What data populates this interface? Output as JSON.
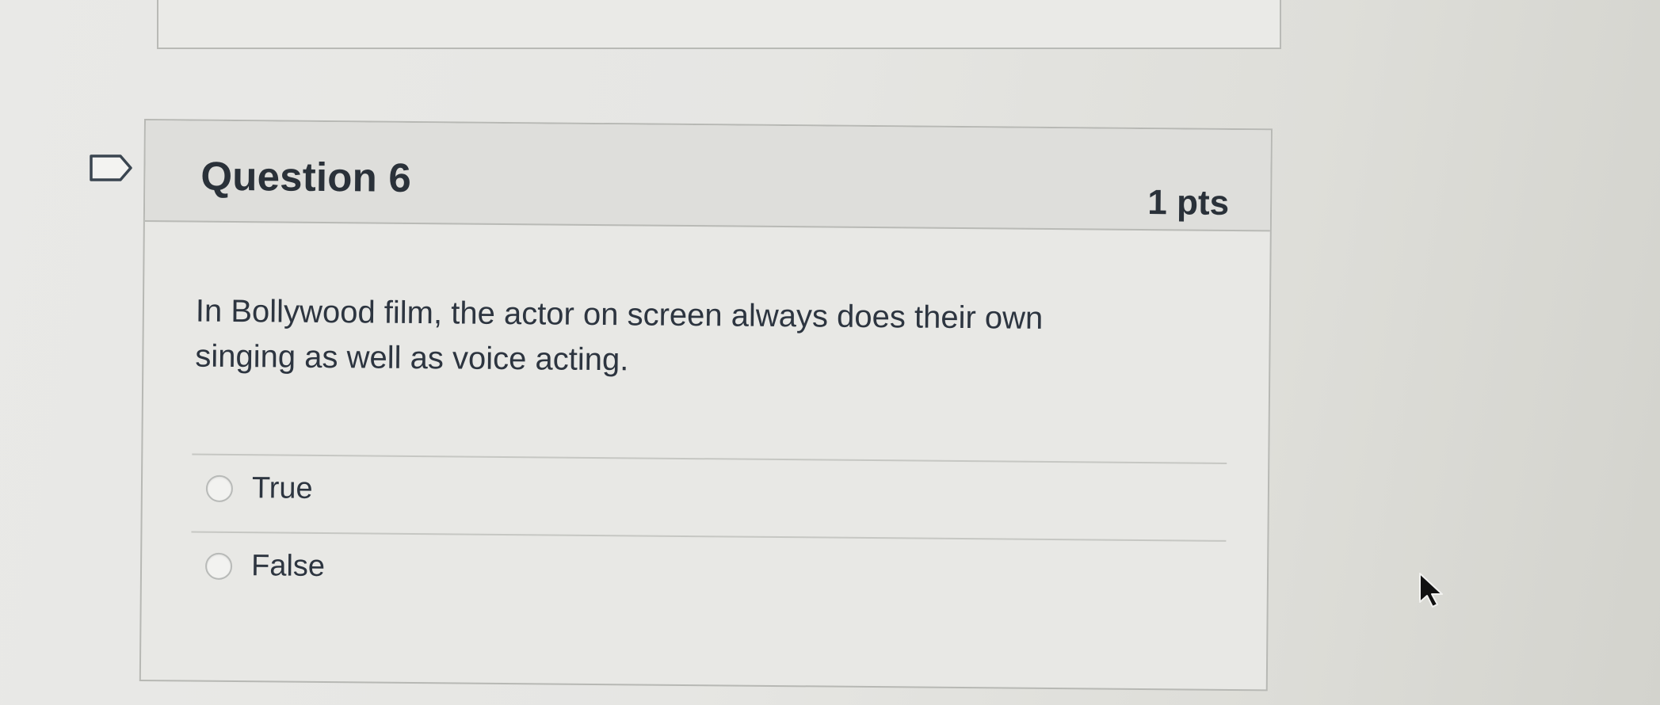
{
  "question": {
    "title": "Question 6",
    "points": "1 pts",
    "text": "In Bollywood film, the actor on screen always does their own singing as well as voice acting.",
    "answers": [
      {
        "label": "True"
      },
      {
        "label": "False"
      }
    ]
  },
  "icons": {
    "flag": "flag-question-icon",
    "cursor": "mouse-pointer-icon"
  },
  "colors": {
    "text": "#2d3540",
    "border": "#b7b8b4",
    "header_bg": "#dededb"
  }
}
